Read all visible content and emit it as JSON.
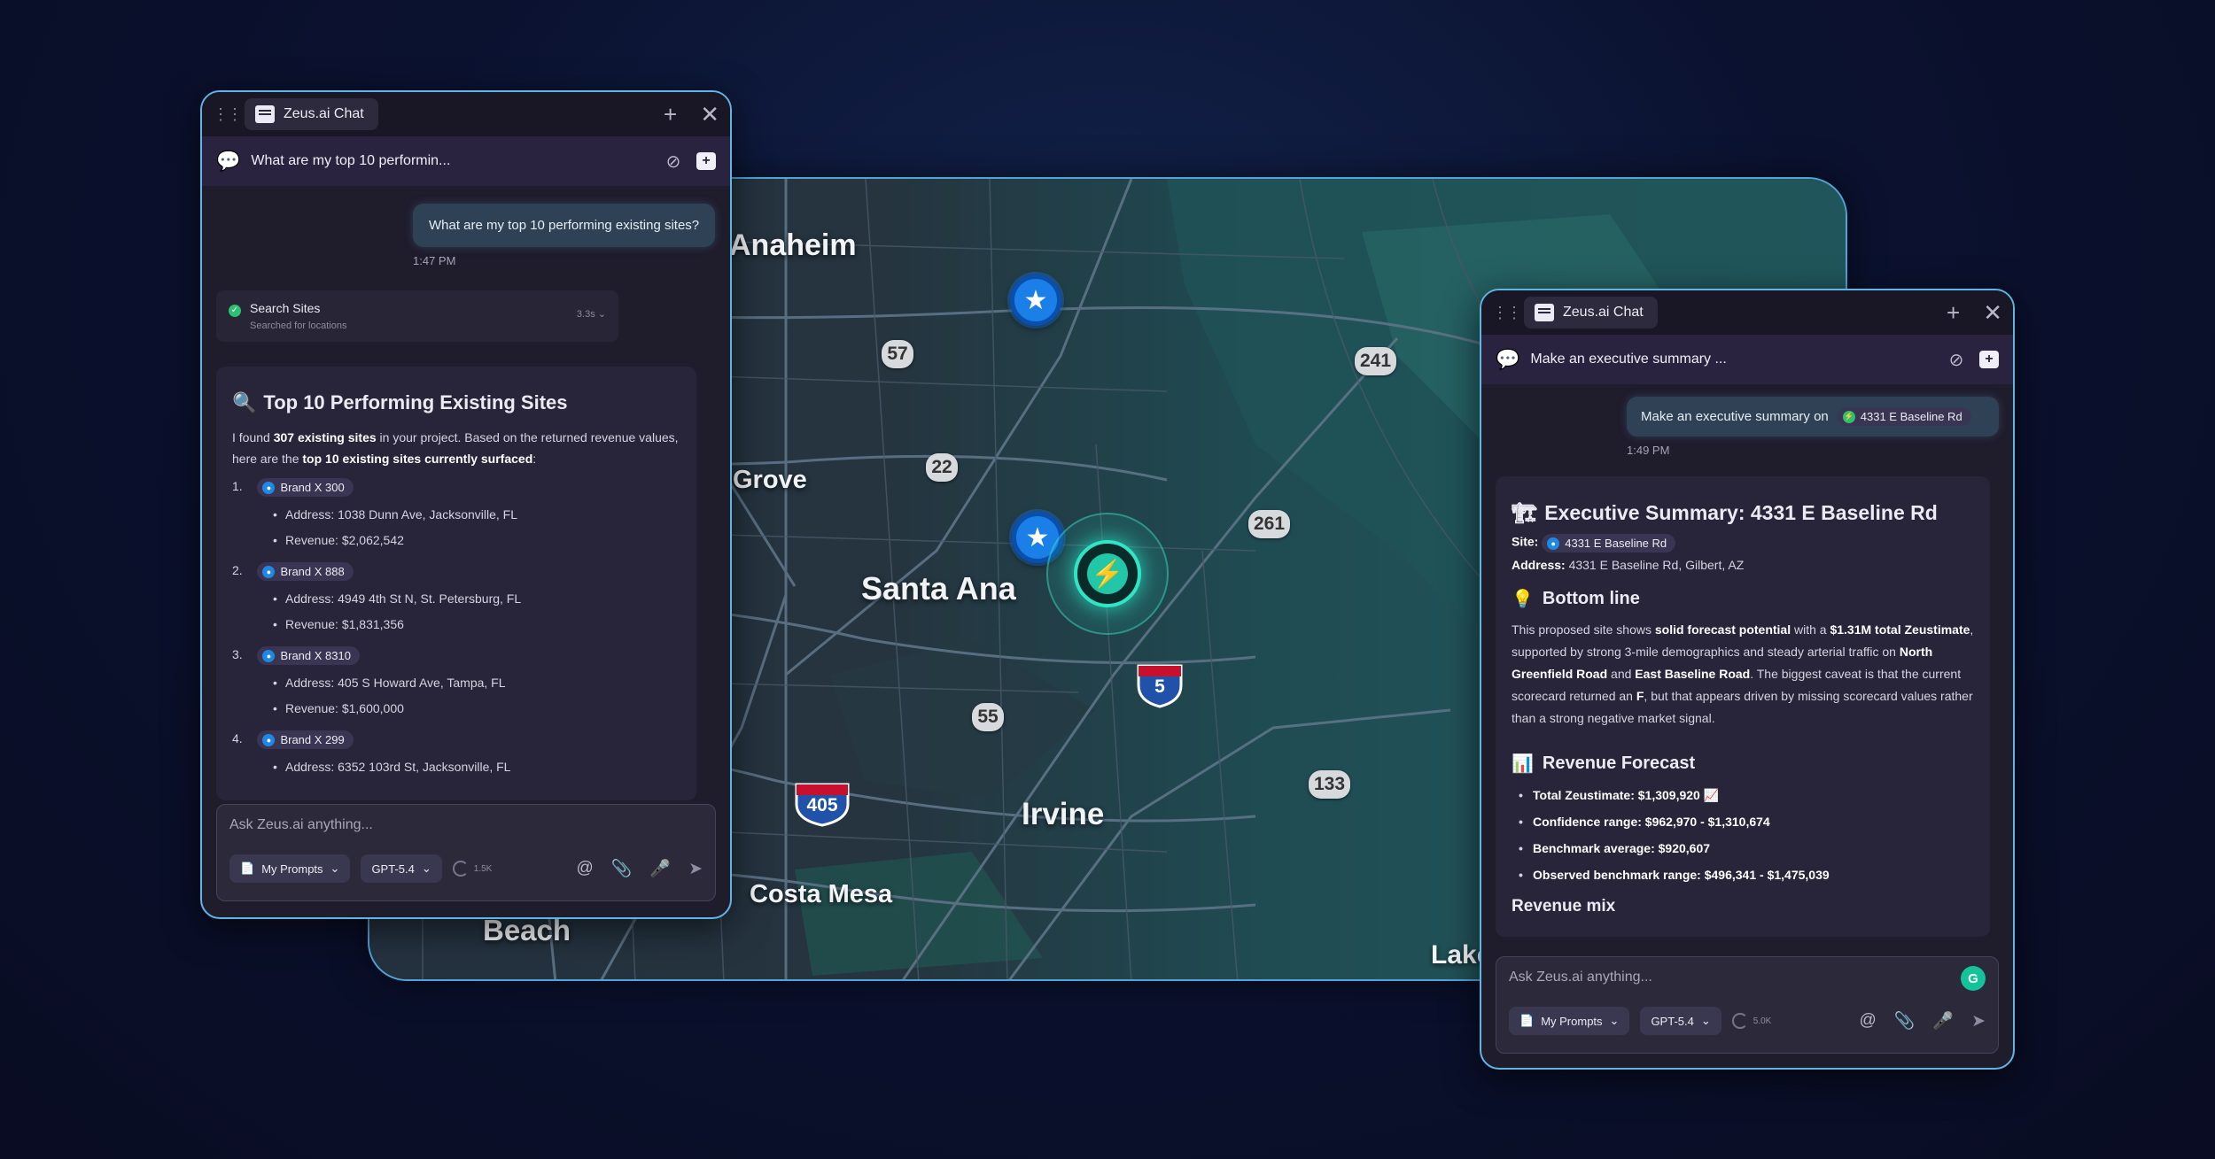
{
  "map": {
    "cities": [
      "Anaheim",
      "Grove",
      "Santa Ana",
      "Irvine",
      "Costa Mesa",
      "Beach",
      "Lake"
    ],
    "route_shields": [
      "57",
      "22",
      "241",
      "261",
      "55",
      "133"
    ],
    "interstates": [
      "5",
      "405"
    ],
    "colors": {
      "frame": "#4ea5d6",
      "star_marker": "#1b7fe8",
      "bolt_marker": "#2ee6c4"
    }
  },
  "left_chat": {
    "tab_title": "Zeus.ai Chat",
    "thread_title": "What are my top 10 performin...",
    "user_message": "What are my top 10 performing existing sites?",
    "user_time": "1:47 PM",
    "tool": {
      "name": "Search Sites",
      "sub": "Searched for locations",
      "duration": "3.3s"
    },
    "answer": {
      "heading": "Top 10 Performing Existing Sites",
      "intro_1": "I found ",
      "intro_count": "307 existing sites",
      "intro_2": " in your project. Based on the returned revenue values, here are the ",
      "intro_bold2": "top 10 existing sites currently surfaced",
      "intro_3": ":",
      "sites": [
        {
          "num": "1.",
          "name": "Brand X 300",
          "address": "Address: 1038 Dunn Ave, Jacksonville, FL",
          "revenue": "Revenue: $2,062,542"
        },
        {
          "num": "2.",
          "name": "Brand X 888",
          "address": "Address: 4949 4th St N, St. Petersburg, FL",
          "revenue": "Revenue: $1,831,356"
        },
        {
          "num": "3.",
          "name": "Brand X 8310",
          "address": "Address: 405 S Howard Ave, Tampa, FL",
          "revenue": "Revenue: $1,600,000"
        },
        {
          "num": "4.",
          "name": "Brand X 299",
          "address": "Address: 6352 103rd St, Jacksonville, FL",
          "revenue": ""
        }
      ]
    },
    "composer": {
      "placeholder": "Ask Zeus.ai anything...",
      "prompts": "My Prompts",
      "model": "GPT-5.4",
      "usage": "1.5K"
    }
  },
  "right_chat": {
    "tab_title": "Zeus.ai Chat",
    "thread_title": "Make an executive summary ...",
    "user_message": "Make an executive summary on",
    "user_chip": "4331 E Baseline Rd",
    "user_time": "1:49 PM",
    "answer": {
      "heading": "Executive Summary: 4331 E Baseline Rd",
      "site_label": "Site:",
      "site_chip": "4331 E Baseline Rd",
      "address_label": "Address:",
      "address_value": "4331 E Baseline Rd, Gilbert, AZ",
      "bottom_line_heading": "Bottom line",
      "bl_1": "This proposed site shows ",
      "bl_b1": "solid forecast potential",
      "bl_2": " with a ",
      "bl_b2": "$1.31M total Zeustimate",
      "bl_3": ", supported by strong 3-mile demographics and steady arterial traffic on ",
      "bl_b3": "North Greenfield Road",
      "bl_4": " and ",
      "bl_b4": "East Baseline Road",
      "bl_5": ". The biggest caveat is that the current scorecard returned an ",
      "bl_b5": "F",
      "bl_6": ", but that appears driven by missing scorecard values rather than a strong negative market signal.",
      "forecast_heading": "Revenue Forecast",
      "forecast_items": [
        "Total Zeustimate: $1,309,920 📈",
        "Confidence range: $962,970 - $1,310,674",
        "Benchmark average: $920,607",
        "Observed benchmark range: $496,341 - $1,475,039"
      ],
      "mix_heading": "Revenue mix"
    },
    "composer": {
      "placeholder": "Ask Zeus.ai anything...",
      "prompts": "My Prompts",
      "model": "GPT-5.4",
      "usage": "5.0K"
    }
  }
}
